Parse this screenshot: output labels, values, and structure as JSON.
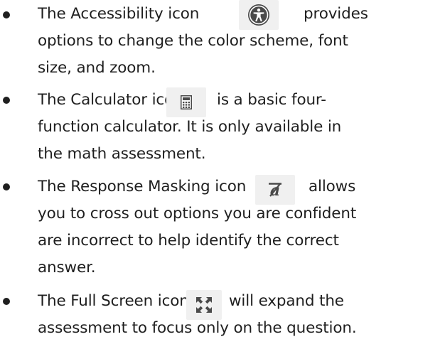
{
  "items": [
    {
      "icon": "accessibility-icon",
      "lines": [
        "The Accessibility icon",
        "provides",
        "options to change the color scheme, font",
        "size, and zoom."
      ]
    },
    {
      "icon": "calculator-icon",
      "lines": [
        "The Calculator icon",
        "is a basic four-",
        "function calculator. It is only available in",
        "the math assessment."
      ]
    },
    {
      "icon": "response-masking-icon",
      "lines": [
        "The Response Masking icon",
        "allows",
        "you to cross out options you are confident",
        "are incorrect to help identify the correct",
        "answer."
      ]
    },
    {
      "icon": "full-screen-icon",
      "lines": [
        "The Full Screen icon",
        "will expand the",
        "assessment to focus only on the question."
      ]
    }
  ],
  "colors": {
    "text": "#1f1f1f",
    "icon_background": "#f0f0f0",
    "accessibility_icon_fill": "#4a4a4a"
  }
}
